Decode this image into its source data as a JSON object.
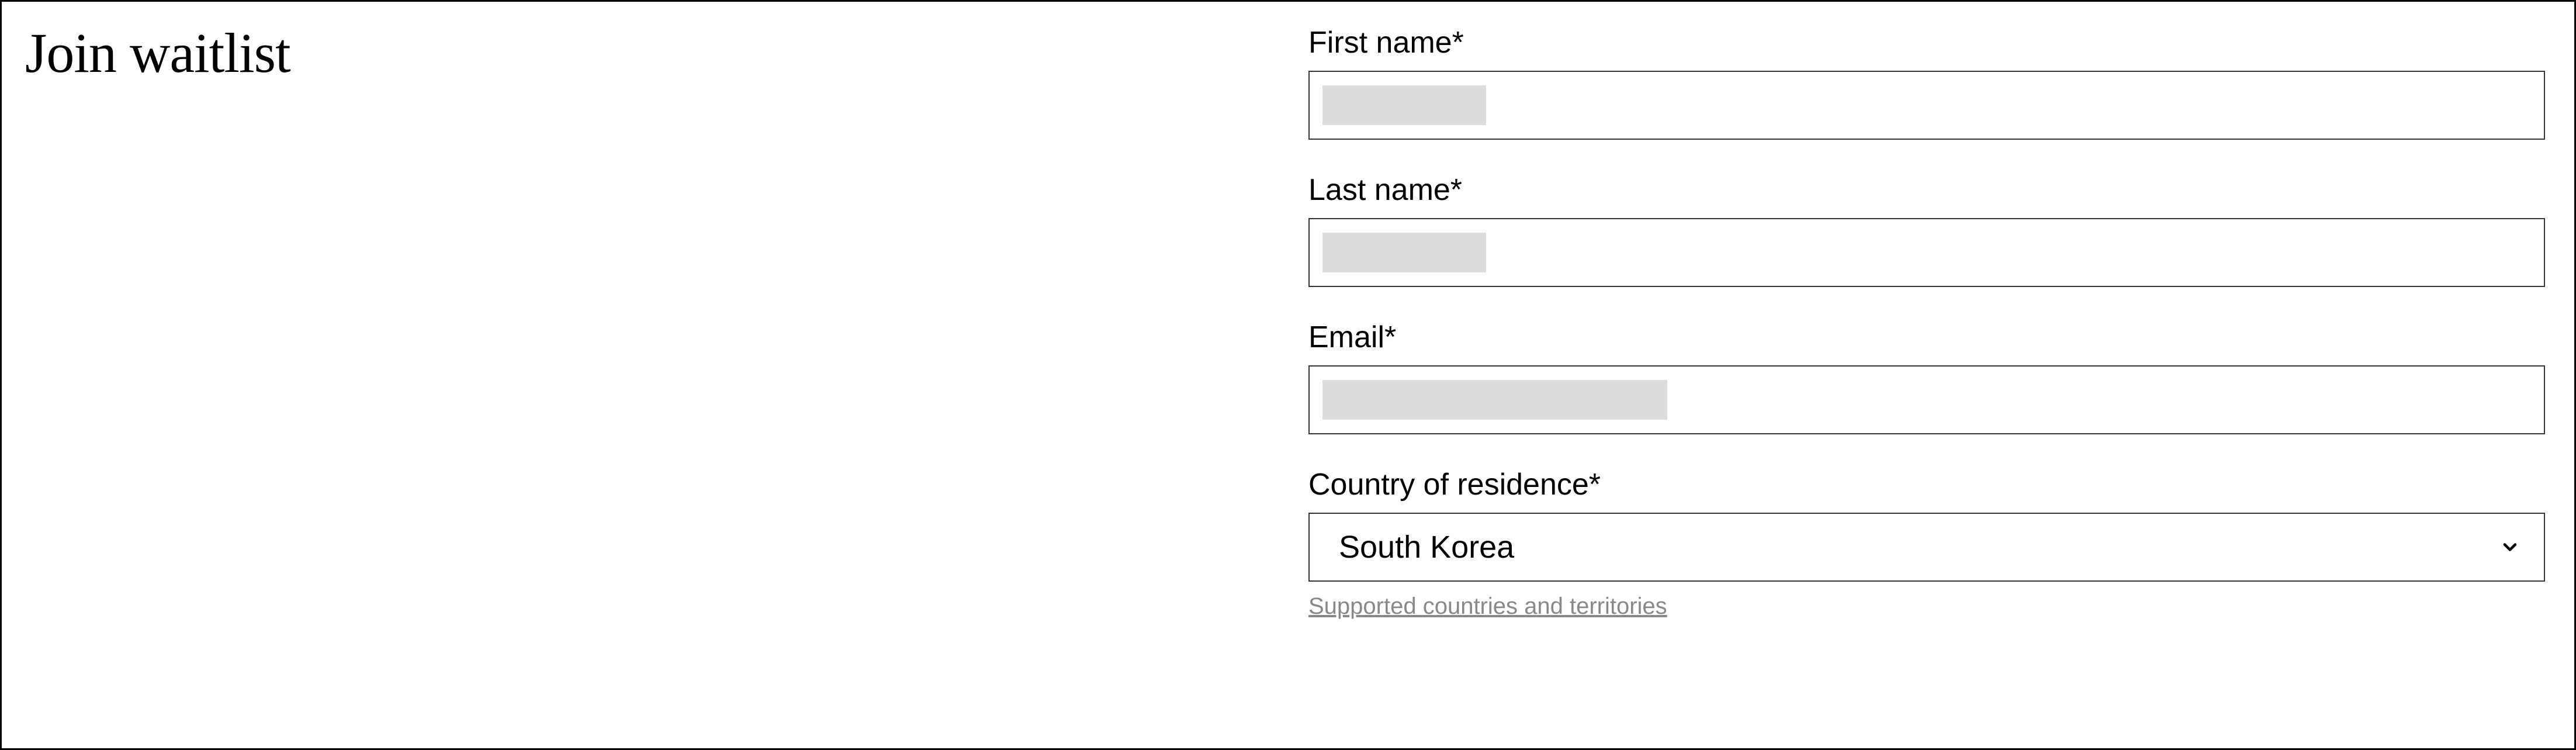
{
  "page": {
    "title": "Join waitlist"
  },
  "form": {
    "first_name": {
      "label": "First name*",
      "value": ""
    },
    "last_name": {
      "label": "Last name*",
      "value": ""
    },
    "email": {
      "label": "Email*",
      "value": ""
    },
    "country": {
      "label": "Country of residence*",
      "selected": "South Korea",
      "help_link": "Supported countries and territories"
    }
  }
}
